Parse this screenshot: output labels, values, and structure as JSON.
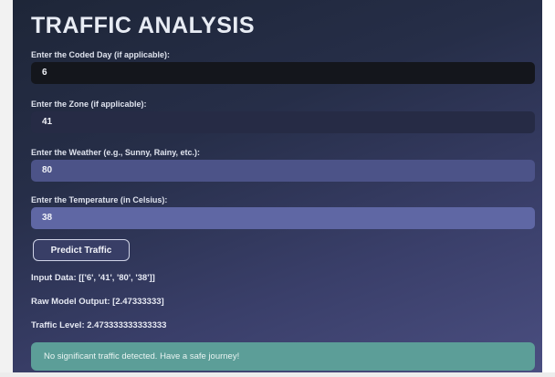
{
  "app": {
    "title": "TRAFFIC ANALYSIS"
  },
  "form": {
    "fields": [
      {
        "label": "Enter the Coded Day (if applicable):",
        "value": "6"
      },
      {
        "label": "Enter the Zone (if applicable):",
        "value": "41"
      },
      {
        "label": "Enter the Weather (e.g., Sunny, Rainy, etc.):",
        "value": "80"
      },
      {
        "label": "Enter the Temperature (in Celsius):",
        "value": "38"
      }
    ],
    "submit_label": "Predict Traffic"
  },
  "results": {
    "input_data": "Input Data: [['6', '41', '80', '38']]",
    "raw_output": "Raw Model Output: [2.47333333]",
    "traffic_level": "Traffic Level: 2.473333333333333",
    "message": "No significant traffic detected. Have a safe journey!"
  },
  "colors": {
    "banner": "#5c9e98",
    "background_top": "#1e2638",
    "background_bottom": "#4a4e80"
  }
}
